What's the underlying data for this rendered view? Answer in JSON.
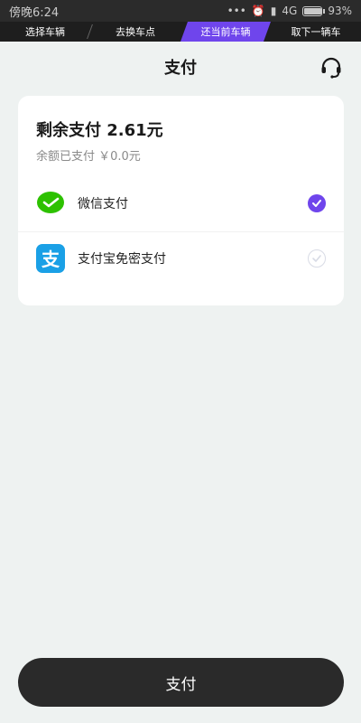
{
  "status_bar": {
    "time": "傍晚6:24",
    "network": "4G",
    "battery": "93%",
    "battery_level": 0.93
  },
  "steps": [
    {
      "label": "选择车辆",
      "active": false
    },
    {
      "label": "去换车点",
      "active": false
    },
    {
      "label": "还当前车辆",
      "active": true
    },
    {
      "label": "取下一辆车",
      "active": false
    }
  ],
  "header": {
    "title": "支付",
    "support_icon": "headset-icon"
  },
  "summary": {
    "remaining": "剩余支付 2.61元",
    "balance_paid": "余额已支付 ￥0.0元"
  },
  "methods": [
    {
      "label": "微信支付",
      "icon": "wechat-icon",
      "selected": true
    },
    {
      "label": "支付宝免密支付",
      "icon": "alipay-icon",
      "icon_glyph": "支",
      "selected": false
    }
  ],
  "colors": {
    "accent": "#6f45ec",
    "button": "#2a2a2a",
    "wechat": "#2dc100",
    "alipay": "#1aa0e6"
  },
  "pay_button": {
    "label": "支付"
  }
}
